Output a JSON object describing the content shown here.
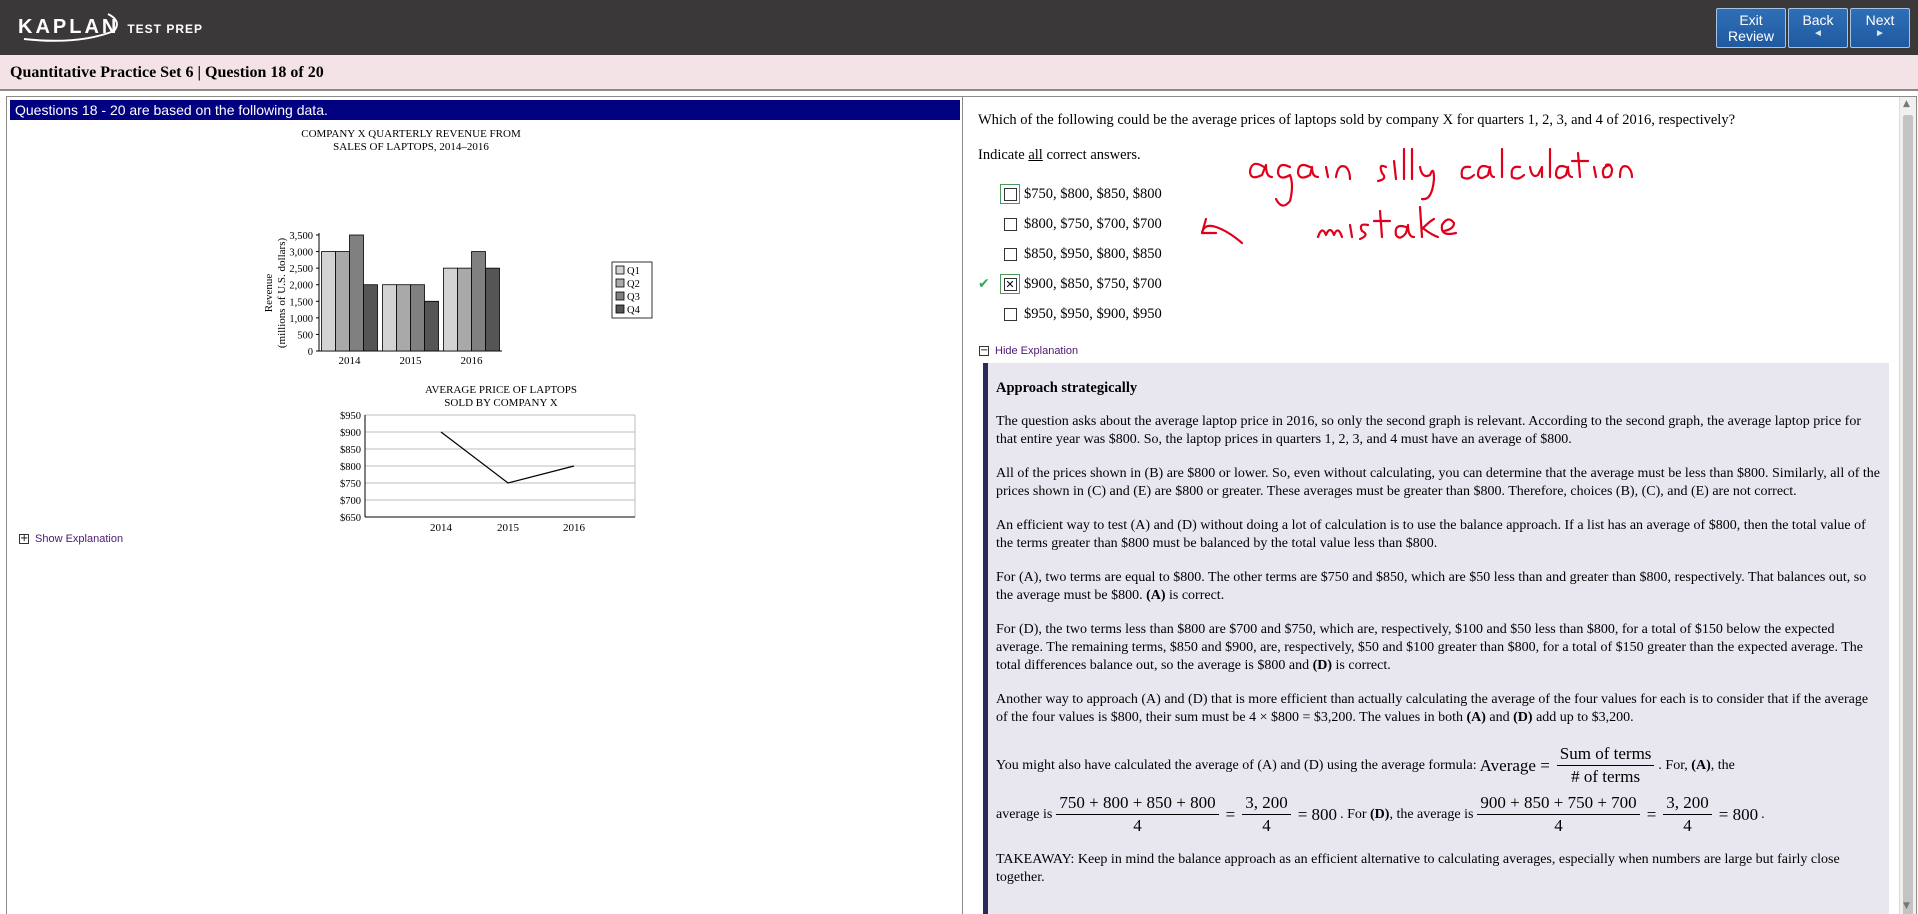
{
  "header": {
    "logo": "KAPLAN",
    "logo_sub": "TEST PREP",
    "buttons": {
      "exit_line1": "Exit",
      "exit_line2": "Review",
      "back": "Back",
      "next": "Next",
      "arrow_left": "◄",
      "arrow_right": "►"
    }
  },
  "title": "Quantitative Practice Set 6 | Question  18 of 20",
  "left_panel": {
    "passage_header": "Questions 18 - 20 are based on the following data.",
    "show_explanation": "Show Explanation",
    "pm_plus": "+"
  },
  "chart_data": [
    {
      "type": "bar",
      "title_line1": "COMPANY X QUARTERLY REVENUE FROM",
      "title_line2": "SALES OF LAPTOPS, 2014–2016",
      "ylabel_line1": "Revenue",
      "ylabel_line2": "(millions of U.S. dollars)",
      "categories": [
        "2014",
        "2015",
        "2016"
      ],
      "series": [
        {
          "name": "Q1",
          "values": [
            3000,
            2000,
            2500
          ],
          "color": "#d3d3d3"
        },
        {
          "name": "Q2",
          "values": [
            3000,
            2000,
            2500
          ],
          "color": "#a9a9a9"
        },
        {
          "name": "Q3",
          "values": [
            3500,
            2000,
            3000
          ],
          "color": "#808080"
        },
        {
          "name": "Q4",
          "values": [
            2000,
            1500,
            2500
          ],
          "color": "#555555"
        }
      ],
      "ylim": [
        0,
        3500
      ],
      "yticks": [
        "0",
        "500",
        "1,000",
        "1,500",
        "2,000",
        "2,500",
        "3,000",
        "3,500"
      ],
      "legend": "top-right"
    },
    {
      "type": "line",
      "title_line1": "AVERAGE PRICE OF LAPTOPS",
      "title_line2": "SOLD BY COMPANY X",
      "x": [
        "2014",
        "2015",
        "2016"
      ],
      "values": [
        900,
        750,
        800
      ],
      "ylim": [
        650,
        950
      ],
      "yticks": [
        "$650",
        "$700",
        "$750",
        "$800",
        "$850",
        "$900",
        "$950"
      ],
      "grid": true
    }
  ],
  "right_panel": {
    "question": "Which of the following could be the average prices of laptops sold by company X for quarters 1, 2, 3, and 4 of 2016, respectively?",
    "indicate_pre": "Indicate ",
    "indicate_u": "all",
    "indicate_post": " correct answers.",
    "choices": [
      {
        "label": "$750, $800, $850, $800",
        "checked": false,
        "correct": false
      },
      {
        "label": "$800, $750, $700, $700",
        "checked": false,
        "correct": false
      },
      {
        "label": "$850, $950, $800, $850",
        "checked": false,
        "correct": false
      },
      {
        "label": "$900, $850, $750, $700",
        "checked": true,
        "correct": true
      },
      {
        "label": "$950, $950, $900, $950",
        "checked": false,
        "correct": false
      }
    ],
    "correct_mark": "✔",
    "checked_mark": "✕",
    "hide_explanation": "Hide Explanation",
    "pm_minus": "−"
  },
  "explanation": {
    "heading": "Approach strategically",
    "p1": "The question asks about the average laptop price in 2016, so only the second graph is relevant. According to the second graph, the average laptop price for that entire year was $800. So, the laptop prices in quarters 1, 2, 3, and 4 must have an average of $800.",
    "p2": "All of the prices shown in (B) are $800 or lower. So, even without calculating, you can determine that the average must be less than $800. Similarly, all of the prices shown in (C) and (E) are $800 or greater. These averages must be greater than $800. Therefore, choices (B), (C), and (E) are not correct.",
    "p3": "An efficient way to test (A) and (D) without doing a lot of calculation is to use the balance approach. If a list has an average of $800, then the total value of the terms greater than $800 must be balanced by the total value less than $800.",
    "p4_a": "For (A), two terms are equal to $800. The other terms are $750 and $850, which are $50 less than and greater than $800, respectively. That balances out, so the average must be $800. ",
    "p4_b": "(A)",
    "p4_c": " is correct.",
    "p5_a": "For (D), the two terms less than $800 are $700 and $750, which are, respectively, $100 and $50 less than $800, for a total of $150 below the expected average. The remaining terms, $850 and $900, are, respectively, $50 and $100 greater than $800, for a total of $150 greater than the expected average. The total differences balance out, so the average is $800 and ",
    "p5_b": "(D)",
    "p5_c": " is correct.",
    "p6_a": "Another way to approach (A) and (D) that is more efficient than actually calculating the average of the four values for each is to consider that if the average of the four values is $800, their sum must be 4 × $800 = $3,200. The values in both ",
    "p6_b": "(A)",
    "p6_c": " and ",
    "p6_d": "(D)",
    "p6_e": " add up to $3,200.",
    "f1_pre": "You might also have calculated the average of (A) and (D) using the average formula: ",
    "f1_lhs": "Average =",
    "f1_num": "Sum of terms",
    "f1_den": "# of terms",
    "f1_post_a": ". For, ",
    "f1_post_b": "(A)",
    "f1_post_c": ", the",
    "f2_pre": "average is",
    "f2_num1": "750 + 800 + 850 + 800",
    "f2_den1": "4",
    "f2_num2": "3, 200",
    "f2_den2": "4",
    "f2_eq": "=",
    "f2_res": "= 800",
    "f2_mid_a": ". For ",
    "f2_mid_b": "(D)",
    "f2_mid_c": ", the average is",
    "f2_num3": "900 + 850 + 750 + 700",
    "f2_den3": "4",
    "f2_num4": "3, 200",
    "f2_den4": "4",
    "f2_end": "= 800",
    "f2_dot": ".",
    "takeaway": "TAKEAWAY: Keep in mind the balance approach as an efficient alternative to calculating averages, especially when numbers are large but fairly close together."
  },
  "annotation_colors": {
    "ink": "#e0001b"
  }
}
